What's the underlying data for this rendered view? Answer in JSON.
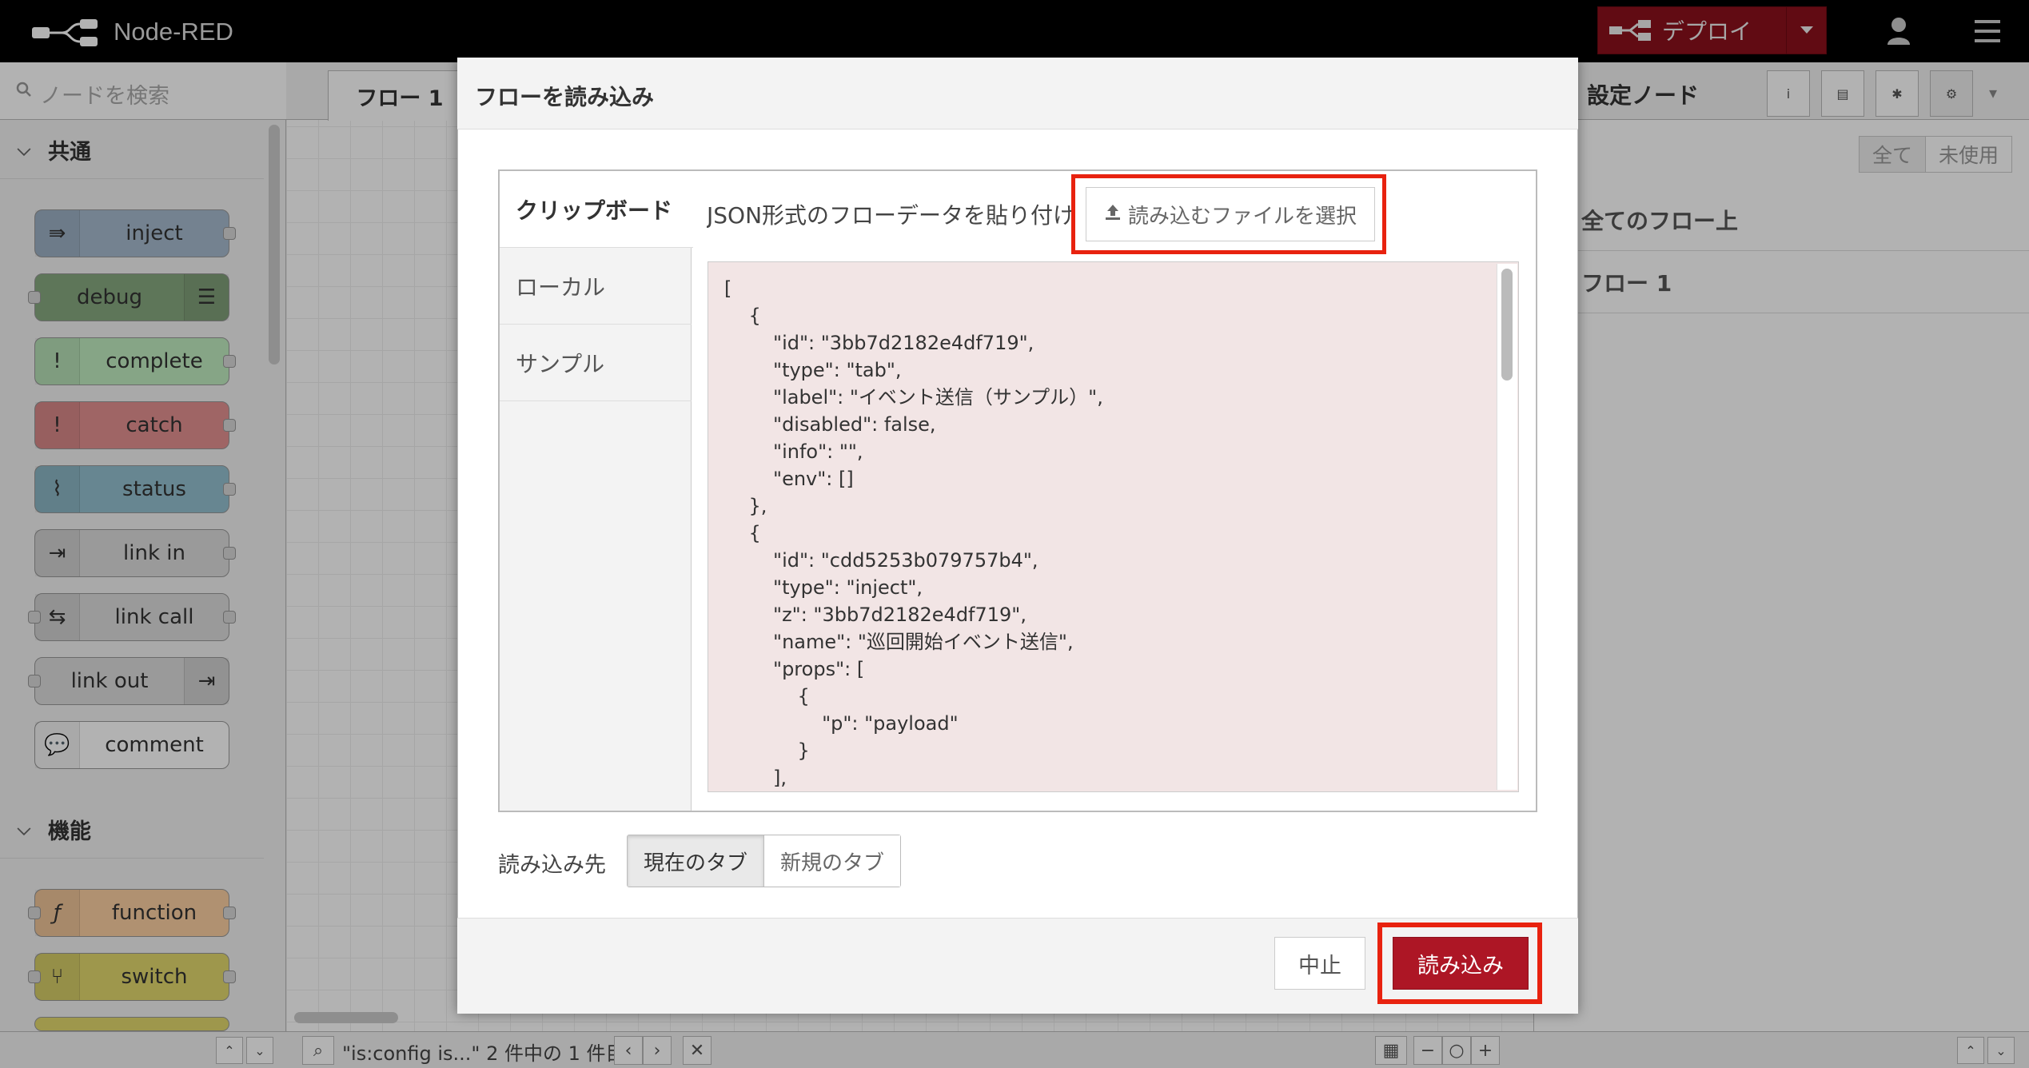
{
  "app": {
    "title": "Node-RED"
  },
  "header": {
    "deploy_label": "デプロイ"
  },
  "palette": {
    "search_placeholder": "ノードを検索",
    "categories": [
      {
        "label": "共通"
      },
      {
        "label": "機能"
      }
    ],
    "nodes": [
      {
        "label": "inject",
        "color": "#a6bbcf"
      },
      {
        "label": "debug",
        "color": "#87a980"
      },
      {
        "label": "complete",
        "color": "#c0edc0"
      },
      {
        "label": "catch",
        "color": "#e49191"
      },
      {
        "label": "status",
        "color": "#94c1d0"
      },
      {
        "label": "link in",
        "color": "#dddddd"
      },
      {
        "label": "link call",
        "color": "#dddddd"
      },
      {
        "label": "link out",
        "color": "#dddddd"
      },
      {
        "label": "comment",
        "color": "#ffffff"
      },
      {
        "label": "function",
        "color": "#fdd0a2"
      },
      {
        "label": "switch",
        "color": "#e2d96e"
      }
    ]
  },
  "workspace": {
    "tab_label": "フロー 1",
    "search_status": "\"is:config is...\" 2 件中の 1 件目"
  },
  "sidebar": {
    "title": "設定ノード",
    "toggle_all": "全て",
    "toggle_unused": "未使用",
    "rows": [
      "全てのフロー上",
      "フロー 1"
    ]
  },
  "dialog": {
    "title": "フローを読み込み",
    "tabs": [
      "クリップボード",
      "ローカル",
      "サンプル"
    ],
    "clipboard_label": "JSON形式のフローデータを貼り付けて下さい",
    "file_button_label": "読み込むファイルを選択",
    "json_text": "[\n    {\n        \"id\": \"3bb7d2182e4df719\",\n        \"type\": \"tab\",\n        \"label\": \"イベント送信（サンプル）\",\n        \"disabled\": false,\n        \"info\": \"\",\n        \"env\": []\n    },\n    {\n        \"id\": \"cdd5253b079757b4\",\n        \"type\": \"inject\",\n        \"z\": \"3bb7d2182e4df719\",\n        \"name\": \"巡回開始イベント送信\",\n        \"props\": [\n            {\n                \"p\": \"payload\"\n            }\n        ],\n        \"repeat\": \"\",",
    "dest_label": "読み込み先",
    "dest_current": "現在のタブ",
    "dest_new": "新規のタブ",
    "cancel_label": "中止",
    "import_label": "読み込み",
    "highlight_color": "#e8220f"
  }
}
